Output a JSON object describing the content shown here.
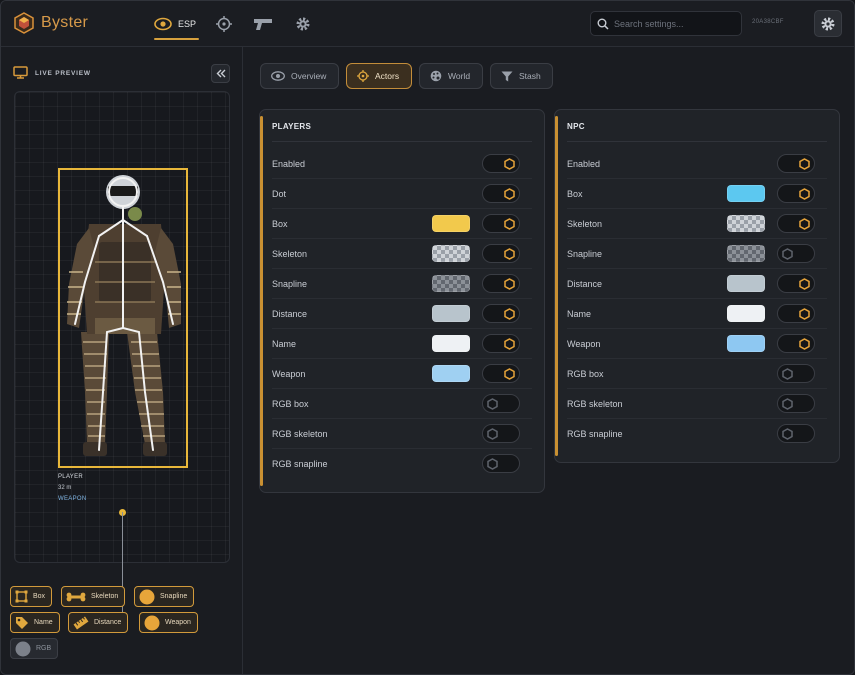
{
  "app": {
    "title": "Byster",
    "build_id": "20A38CBF"
  },
  "nav": {
    "esp_label": "ESP"
  },
  "search": {
    "placeholder": "Search settings..."
  },
  "preview": {
    "title": "LIVE PREVIEW",
    "player_label": "PLAYER",
    "distance": "32 m",
    "weapon": "WEAPON"
  },
  "chips": [
    {
      "label": "Box",
      "icon": "box-icon",
      "active": true
    },
    {
      "label": "Skeleton",
      "icon": "bone-icon",
      "active": true
    },
    {
      "label": "Snapline",
      "icon": "dot-icon",
      "active": true
    },
    {
      "label": "Name",
      "icon": "tag-icon",
      "active": true
    },
    {
      "label": "Distance",
      "icon": "ruler-icon",
      "active": true
    },
    {
      "label": "Weapon",
      "icon": "dot-icon",
      "active": true
    },
    {
      "label": "RGB",
      "icon": "dot-icon",
      "active": false
    }
  ],
  "subtabs": [
    {
      "label": "Overview",
      "icon": "eye-icon"
    },
    {
      "label": "Actors",
      "icon": "crosshair-icon",
      "active": true
    },
    {
      "label": "World",
      "icon": "palette-icon"
    },
    {
      "label": "Stash",
      "icon": "filter-icon"
    }
  ],
  "players": {
    "title": "PLAYERS",
    "rows": [
      {
        "label": "Enabled",
        "on": true
      },
      {
        "label": "Dot",
        "on": true
      },
      {
        "label": "Box",
        "on": true,
        "color": "#f2c94c"
      },
      {
        "label": "Skeleton",
        "on": true,
        "color": "checker"
      },
      {
        "label": "Snapline",
        "on": true,
        "color": "checker-dark"
      },
      {
        "label": "Distance",
        "on": true,
        "color": "#b8c4cc"
      },
      {
        "label": "Name",
        "on": true,
        "color": "#eef1f4"
      },
      {
        "label": "Weapon",
        "on": true,
        "color": "#9fd0f2"
      },
      {
        "label": "RGB box",
        "on": false
      },
      {
        "label": "RGB skeleton",
        "on": false
      },
      {
        "label": "RGB snapline",
        "on": false
      }
    ]
  },
  "npc": {
    "title": "NPC",
    "rows": [
      {
        "label": "Enabled",
        "on": true
      },
      {
        "label": "Box",
        "on": true,
        "color": "#5cc8f0"
      },
      {
        "label": "Skeleton",
        "on": true,
        "color": "checker"
      },
      {
        "label": "Snapline",
        "on": false,
        "color": "checker-dark"
      },
      {
        "label": "Distance",
        "on": true,
        "color": "#b8c4cc"
      },
      {
        "label": "Name",
        "on": true,
        "color": "#eef1f4"
      },
      {
        "label": "Weapon",
        "on": true,
        "color": "#8ec8f2"
      },
      {
        "label": "RGB box",
        "on": false
      },
      {
        "label": "RGB skeleton",
        "on": false
      },
      {
        "label": "RGB snapline",
        "on": false
      }
    ]
  },
  "colors": {
    "accent": "#d7a13e",
    "box": "#e8b73a"
  }
}
